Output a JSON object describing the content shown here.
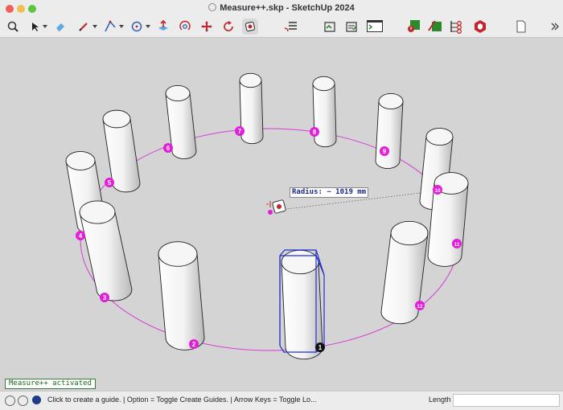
{
  "window": {
    "title": "Measure++.skp - SketchUp 2024"
  },
  "toolbar": {
    "icons": [
      "search-icon",
      "select-arrow-icon",
      "eraser-icon",
      "pencil-icon",
      "polygon-icon",
      "circle-tool-icon",
      "push-pull-icon",
      "orbit-icon",
      "move-icon",
      "rotate-icon",
      "measure-plus-icon",
      "outliner-icon",
      "extension-icon",
      "report-icon",
      "terminal-icon",
      "error-check-icon",
      "component-icon",
      "network-icon",
      "ruby-icon",
      "document-icon",
      "overflow-chevron-icon"
    ]
  },
  "viewport": {
    "tooltip": "Radius: ~ 1019 mm",
    "markers": [
      "1",
      "2",
      "3",
      "4",
      "5",
      "6",
      "7",
      "8",
      "9",
      "10",
      "11",
      "12"
    ],
    "colors": {
      "circle": "#d63bd4",
      "marker": "#e21ed8",
      "selection": "#1f2fd0",
      "background": "#d4d4d4"
    }
  },
  "status": {
    "message": "Measure++ activated",
    "hint": "Click to create a guide. | Option = Toggle Create Guides. | Arrow Keys = Toggle Lo...",
    "length_label": "Length",
    "length_value": ""
  }
}
